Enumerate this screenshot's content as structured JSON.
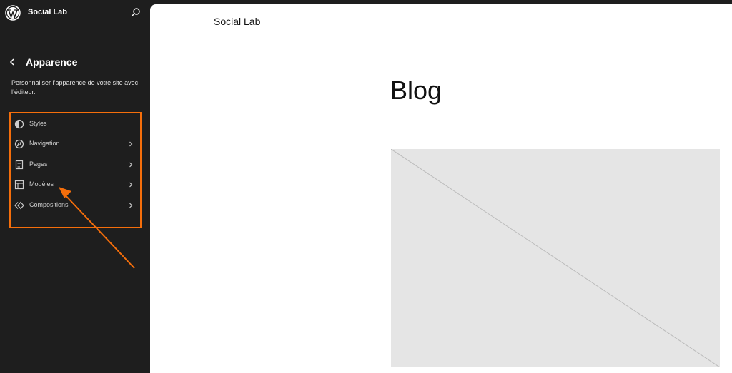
{
  "header": {
    "site_name": "Social Lab"
  },
  "sidebar": {
    "title": "Apparence",
    "description": "Personnaliser l’apparence de votre site avec l’éditeur.",
    "items": [
      {
        "label": "Styles",
        "icon": "half-circle-icon",
        "has_chevron": false
      },
      {
        "label": "Navigation",
        "icon": "compass-icon",
        "has_chevron": true
      },
      {
        "label": "Pages",
        "icon": "page-icon",
        "has_chevron": true
      },
      {
        "label": "Modèles",
        "icon": "layout-icon",
        "has_chevron": true
      },
      {
        "label": "Compositions",
        "icon": "symbol-icon",
        "has_chevron": true
      }
    ],
    "highlight_color": "#f56e0b"
  },
  "canvas": {
    "site_title": "Social Lab",
    "page_title": "Blog"
  }
}
